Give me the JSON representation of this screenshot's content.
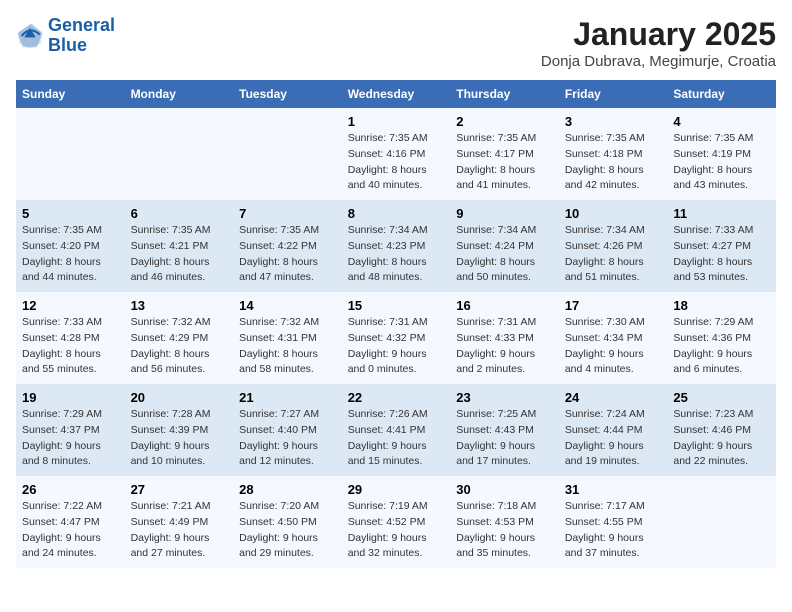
{
  "header": {
    "logo_line1": "General",
    "logo_line2": "Blue",
    "title": "January 2025",
    "subtitle": "Donja Dubrava, Megimurje, Croatia"
  },
  "days_of_week": [
    "Sunday",
    "Monday",
    "Tuesday",
    "Wednesday",
    "Thursday",
    "Friday",
    "Saturday"
  ],
  "weeks": [
    [
      {
        "day": "",
        "info": ""
      },
      {
        "day": "",
        "info": ""
      },
      {
        "day": "",
        "info": ""
      },
      {
        "day": "1",
        "info": "Sunrise: 7:35 AM\nSunset: 4:16 PM\nDaylight: 8 hours\nand 40 minutes."
      },
      {
        "day": "2",
        "info": "Sunrise: 7:35 AM\nSunset: 4:17 PM\nDaylight: 8 hours\nand 41 minutes."
      },
      {
        "day": "3",
        "info": "Sunrise: 7:35 AM\nSunset: 4:18 PM\nDaylight: 8 hours\nand 42 minutes."
      },
      {
        "day": "4",
        "info": "Sunrise: 7:35 AM\nSunset: 4:19 PM\nDaylight: 8 hours\nand 43 minutes."
      }
    ],
    [
      {
        "day": "5",
        "info": "Sunrise: 7:35 AM\nSunset: 4:20 PM\nDaylight: 8 hours\nand 44 minutes."
      },
      {
        "day": "6",
        "info": "Sunrise: 7:35 AM\nSunset: 4:21 PM\nDaylight: 8 hours\nand 46 minutes."
      },
      {
        "day": "7",
        "info": "Sunrise: 7:35 AM\nSunset: 4:22 PM\nDaylight: 8 hours\nand 47 minutes."
      },
      {
        "day": "8",
        "info": "Sunrise: 7:34 AM\nSunset: 4:23 PM\nDaylight: 8 hours\nand 48 minutes."
      },
      {
        "day": "9",
        "info": "Sunrise: 7:34 AM\nSunset: 4:24 PM\nDaylight: 8 hours\nand 50 minutes."
      },
      {
        "day": "10",
        "info": "Sunrise: 7:34 AM\nSunset: 4:26 PM\nDaylight: 8 hours\nand 51 minutes."
      },
      {
        "day": "11",
        "info": "Sunrise: 7:33 AM\nSunset: 4:27 PM\nDaylight: 8 hours\nand 53 minutes."
      }
    ],
    [
      {
        "day": "12",
        "info": "Sunrise: 7:33 AM\nSunset: 4:28 PM\nDaylight: 8 hours\nand 55 minutes."
      },
      {
        "day": "13",
        "info": "Sunrise: 7:32 AM\nSunset: 4:29 PM\nDaylight: 8 hours\nand 56 minutes."
      },
      {
        "day": "14",
        "info": "Sunrise: 7:32 AM\nSunset: 4:31 PM\nDaylight: 8 hours\nand 58 minutes."
      },
      {
        "day": "15",
        "info": "Sunrise: 7:31 AM\nSunset: 4:32 PM\nDaylight: 9 hours\nand 0 minutes."
      },
      {
        "day": "16",
        "info": "Sunrise: 7:31 AM\nSunset: 4:33 PM\nDaylight: 9 hours\nand 2 minutes."
      },
      {
        "day": "17",
        "info": "Sunrise: 7:30 AM\nSunset: 4:34 PM\nDaylight: 9 hours\nand 4 minutes."
      },
      {
        "day": "18",
        "info": "Sunrise: 7:29 AM\nSunset: 4:36 PM\nDaylight: 9 hours\nand 6 minutes."
      }
    ],
    [
      {
        "day": "19",
        "info": "Sunrise: 7:29 AM\nSunset: 4:37 PM\nDaylight: 9 hours\nand 8 minutes."
      },
      {
        "day": "20",
        "info": "Sunrise: 7:28 AM\nSunset: 4:39 PM\nDaylight: 9 hours\nand 10 minutes."
      },
      {
        "day": "21",
        "info": "Sunrise: 7:27 AM\nSunset: 4:40 PM\nDaylight: 9 hours\nand 12 minutes."
      },
      {
        "day": "22",
        "info": "Sunrise: 7:26 AM\nSunset: 4:41 PM\nDaylight: 9 hours\nand 15 minutes."
      },
      {
        "day": "23",
        "info": "Sunrise: 7:25 AM\nSunset: 4:43 PM\nDaylight: 9 hours\nand 17 minutes."
      },
      {
        "day": "24",
        "info": "Sunrise: 7:24 AM\nSunset: 4:44 PM\nDaylight: 9 hours\nand 19 minutes."
      },
      {
        "day": "25",
        "info": "Sunrise: 7:23 AM\nSunset: 4:46 PM\nDaylight: 9 hours\nand 22 minutes."
      }
    ],
    [
      {
        "day": "26",
        "info": "Sunrise: 7:22 AM\nSunset: 4:47 PM\nDaylight: 9 hours\nand 24 minutes."
      },
      {
        "day": "27",
        "info": "Sunrise: 7:21 AM\nSunset: 4:49 PM\nDaylight: 9 hours\nand 27 minutes."
      },
      {
        "day": "28",
        "info": "Sunrise: 7:20 AM\nSunset: 4:50 PM\nDaylight: 9 hours\nand 29 minutes."
      },
      {
        "day": "29",
        "info": "Sunrise: 7:19 AM\nSunset: 4:52 PM\nDaylight: 9 hours\nand 32 minutes."
      },
      {
        "day": "30",
        "info": "Sunrise: 7:18 AM\nSunset: 4:53 PM\nDaylight: 9 hours\nand 35 minutes."
      },
      {
        "day": "31",
        "info": "Sunrise: 7:17 AM\nSunset: 4:55 PM\nDaylight: 9 hours\nand 37 minutes."
      },
      {
        "day": "",
        "info": ""
      }
    ]
  ]
}
